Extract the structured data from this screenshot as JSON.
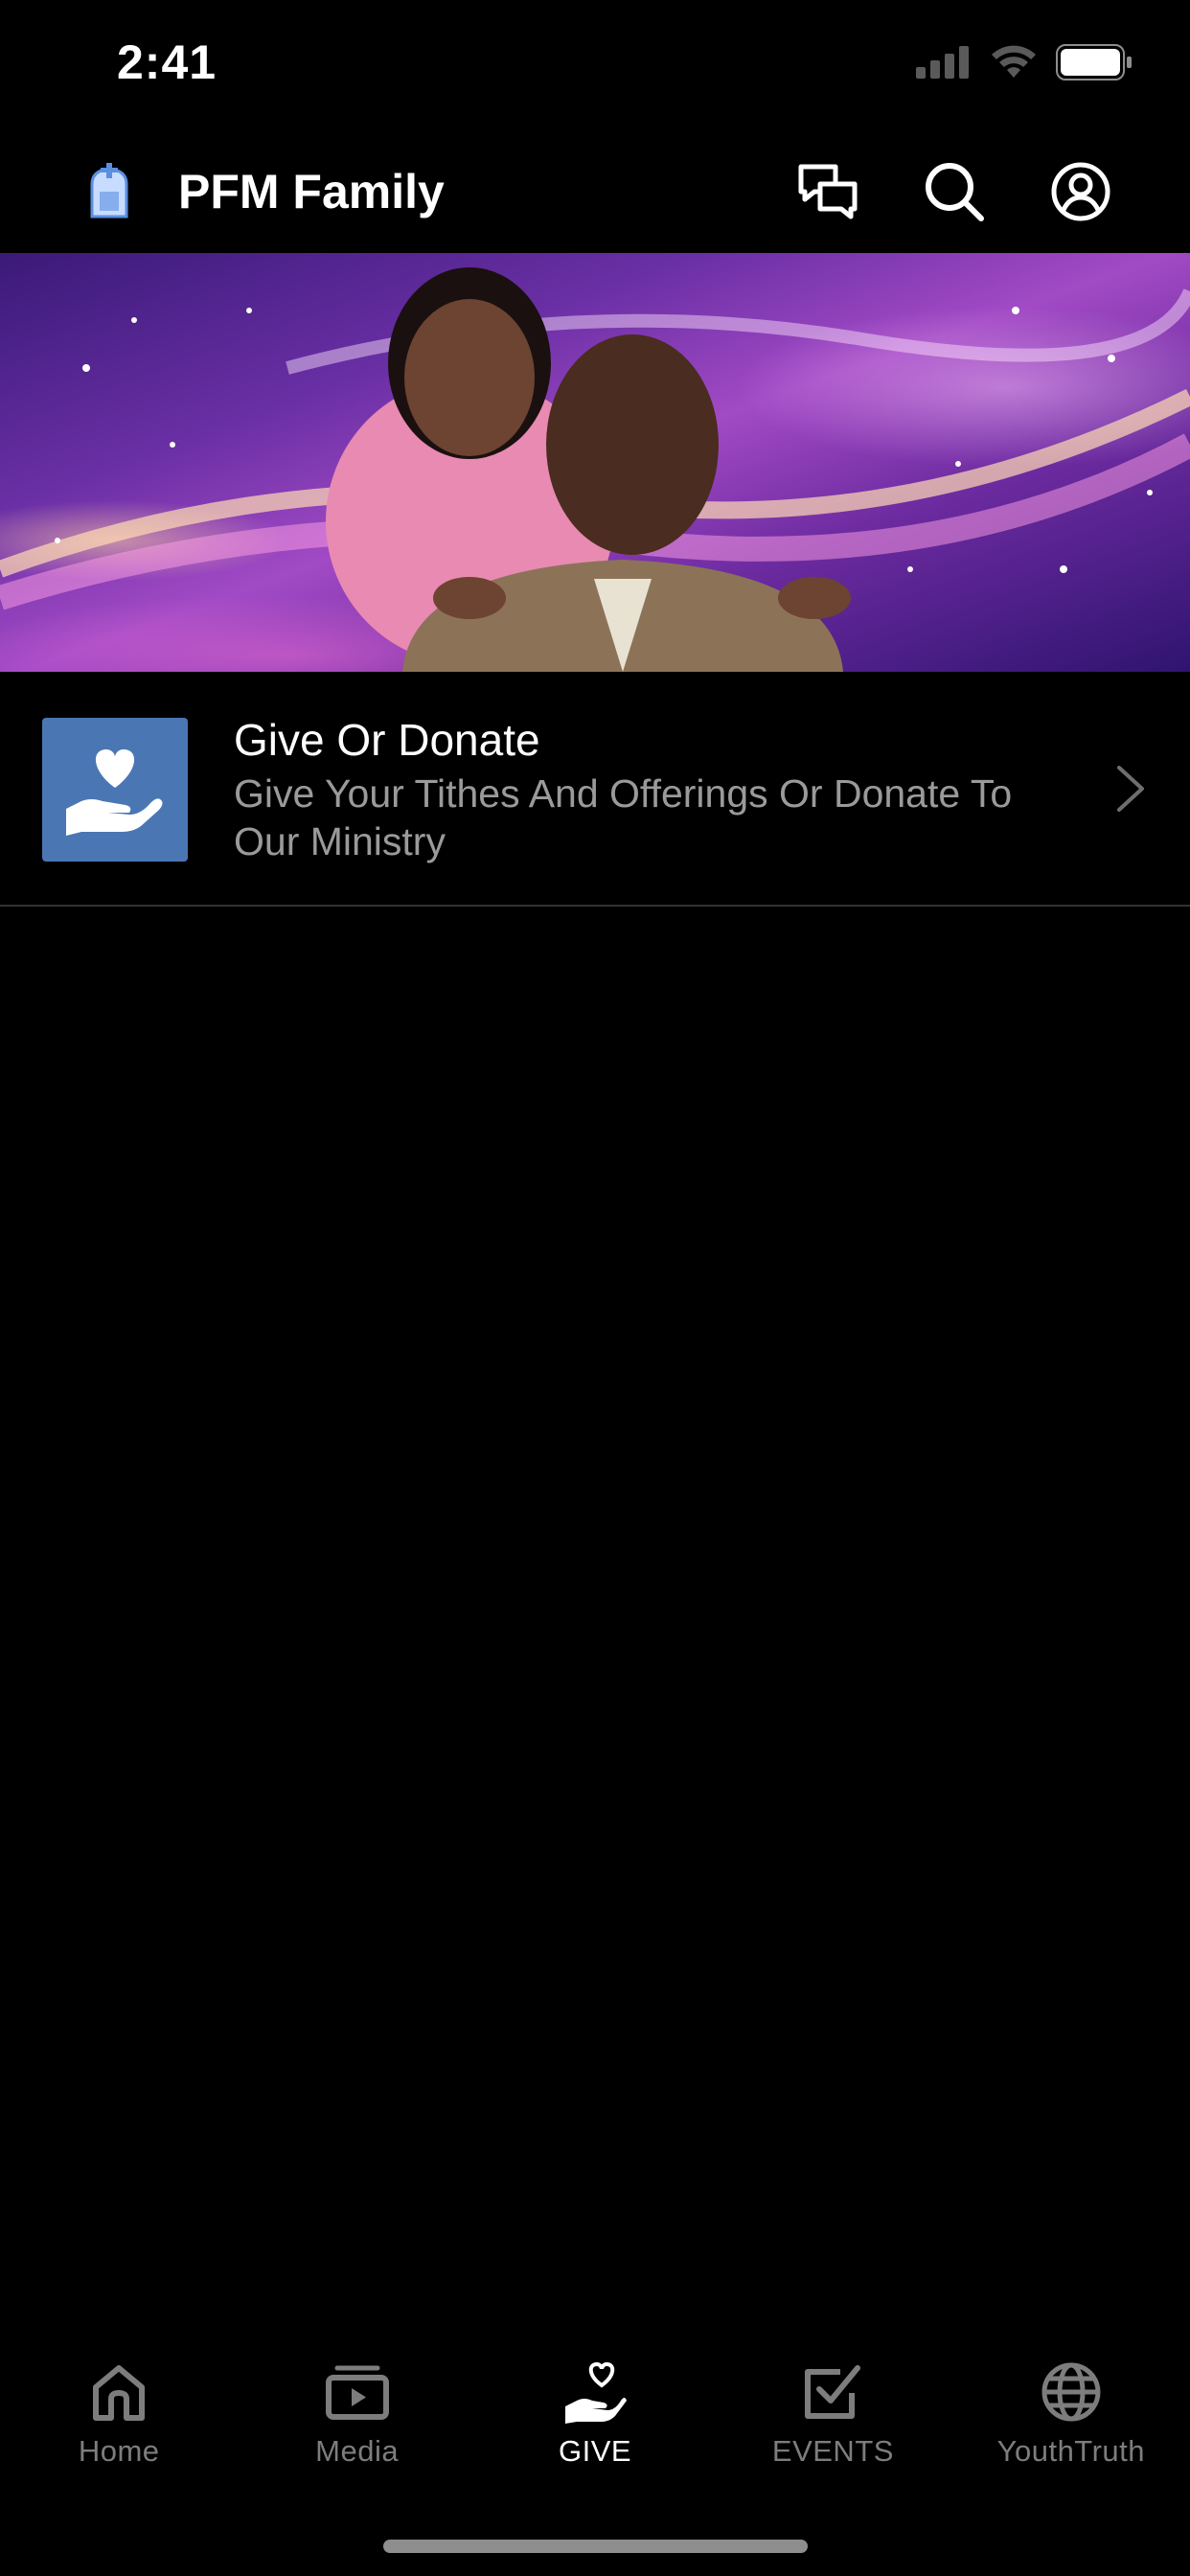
{
  "status_bar": {
    "time": "2:41"
  },
  "header": {
    "title": "PFM Family",
    "icons": [
      "app-logo-icon",
      "chat-icon",
      "search-icon",
      "account-icon"
    ]
  },
  "banner": {
    "description_icon": "pastors-photo"
  },
  "give_item": {
    "title": "Give Or Donate",
    "subtitle": "Give Your Tithes And Offerings Or Donate To Our Ministry",
    "icon": "heart-hand-icon",
    "icon_bg": "#4a77b4"
  },
  "tab_bar": {
    "tabs": [
      {
        "label": "Home",
        "icon": "home-icon",
        "active": false
      },
      {
        "label": "Media",
        "icon": "media-icon",
        "active": false
      },
      {
        "label": "GIVE",
        "icon": "give-icon",
        "active": true
      },
      {
        "label": "EVENTS",
        "icon": "events-icon",
        "active": false
      },
      {
        "label": "YouthTruth",
        "icon": "globe-icon",
        "active": false
      }
    ]
  },
  "colors": {
    "background": "#000000",
    "text_primary": "#ffffff",
    "text_secondary": "#9a9a9a",
    "tab_inactive": "#7d7d7d"
  }
}
